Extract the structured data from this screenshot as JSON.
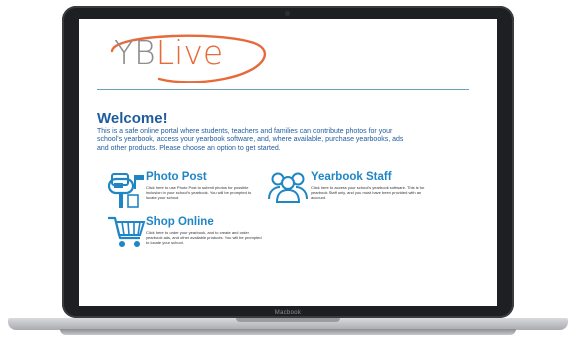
{
  "device": {
    "model_label": "Macbook"
  },
  "logo": {
    "text_yb": "YB",
    "text_live": "Live"
  },
  "welcome": {
    "title": "Welcome!",
    "body": "This is a safe online portal where students, teachers and families can contribute photos for your school's yearbook, access your yearbook software, and, where available, purchase yearbooks, ads and other products. Please choose an option to get started."
  },
  "options": [
    {
      "title": "Photo Post",
      "description": "Click here to use Photo Post to submit photos for possible inclusion in your school's yearbook. You will be prompted to locate your school.",
      "icon": "mailbox-icon"
    },
    {
      "title": "Yearbook Staff",
      "description": "Click here to access your school's yearbook software. This is for yearbook Staff only, and you must have been provided with an account.",
      "icon": "people-group-icon"
    },
    {
      "title": "Shop Online",
      "description": "Click here to order your yearbook, and to create and order yearbook ads, and other available products. You will be prompted to locate your school.",
      "icon": "shopping-cart-icon"
    }
  ],
  "colors": {
    "brand_blue": "#1f5c9e",
    "link_blue": "#1f86c6",
    "logo_orange": "#e76a3a",
    "logo_gray": "#8d8d8d",
    "rule": "#6aa2b8"
  }
}
